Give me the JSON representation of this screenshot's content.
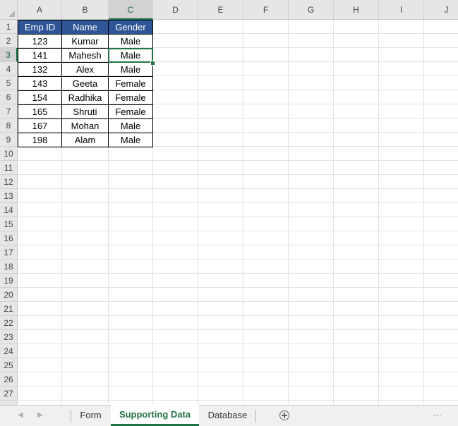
{
  "columns": [
    "A",
    "B",
    "C",
    "D",
    "E",
    "F",
    "G",
    "H",
    "I",
    "J"
  ],
  "rows": [
    "1",
    "2",
    "3",
    "4",
    "5",
    "6",
    "7",
    "8",
    "9",
    "10",
    "11",
    "12",
    "13",
    "14",
    "15",
    "16",
    "17",
    "18",
    "19",
    "20",
    "21",
    "22",
    "23",
    "24",
    "25",
    "26",
    "27"
  ],
  "selected": {
    "column": "C",
    "row": "3"
  },
  "table": {
    "headers": [
      "Emp ID",
      "Name",
      "Gender"
    ],
    "rows": [
      [
        "123",
        "Kumar",
        "Male"
      ],
      [
        "141",
        "Mahesh",
        "Male"
      ],
      [
        "132",
        "Alex",
        "Male"
      ],
      [
        "143",
        "Geeta",
        "Female"
      ],
      [
        "154",
        "Radhika",
        "Female"
      ],
      [
        "165",
        "Shruti",
        "Female"
      ],
      [
        "167",
        "Mohan",
        "Male"
      ],
      [
        "198",
        "Alam",
        "Male"
      ]
    ]
  },
  "colors": {
    "header_fill": "#2f5597",
    "accent": "#217346"
  },
  "tabs": [
    {
      "label": "Form",
      "active": false
    },
    {
      "label": "Supporting Data",
      "active": true
    },
    {
      "label": "Database",
      "active": false
    }
  ],
  "icons": {
    "prev": "chevron-left-icon",
    "next": "chevron-right-icon",
    "add": "plus-circle-icon",
    "more": "vertical-dots-icon"
  }
}
